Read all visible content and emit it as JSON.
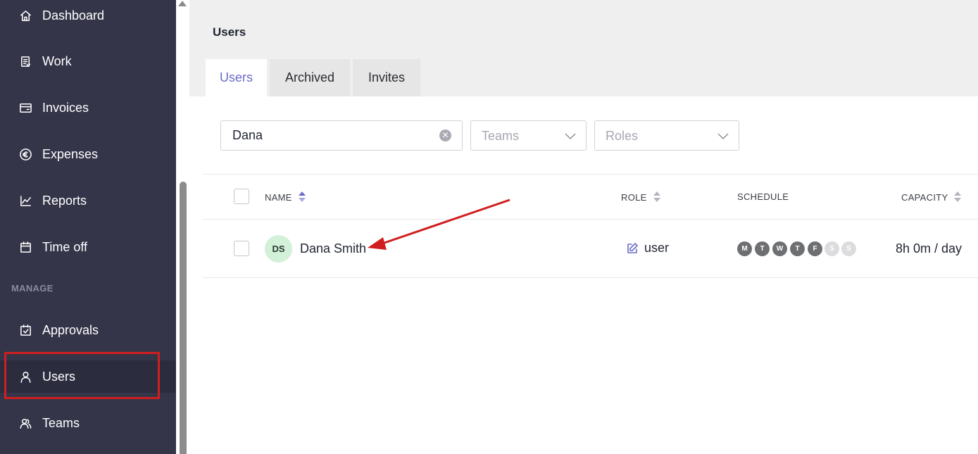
{
  "sidebar": {
    "items": [
      {
        "label": "Dashboard",
        "icon": "home-icon"
      },
      {
        "label": "Work",
        "icon": "clipboard-icon"
      },
      {
        "label": "Invoices",
        "icon": "invoice-icon"
      },
      {
        "label": "Expenses",
        "icon": "euro-icon"
      },
      {
        "label": "Reports",
        "icon": "chart-icon"
      },
      {
        "label": "Time off",
        "icon": "calendar-icon"
      }
    ],
    "section_label": "MANAGE",
    "manage_items": [
      {
        "label": "Approvals",
        "icon": "calendar-check-icon"
      },
      {
        "label": "Users",
        "icon": "user-icon",
        "active": true
      },
      {
        "label": "Teams",
        "icon": "team-icon"
      }
    ]
  },
  "page": {
    "title": "Users",
    "tabs": [
      {
        "label": "Users",
        "active": true
      },
      {
        "label": "Archived"
      },
      {
        "label": "Invites"
      }
    ]
  },
  "filters": {
    "search_value": "Dana",
    "teams_placeholder": "Teams",
    "roles_placeholder": "Roles"
  },
  "table": {
    "columns": {
      "name": "NAME",
      "role": "ROLE",
      "schedule": "SCHEDULE",
      "capacity": "CAPACITY"
    },
    "rows": [
      {
        "initials": "DS",
        "name": "Dana Smith",
        "role": "user",
        "schedule": [
          {
            "day": "M",
            "working": true
          },
          {
            "day": "T",
            "working": true
          },
          {
            "day": "W",
            "working": true
          },
          {
            "day": "T",
            "working": true
          },
          {
            "day": "F",
            "working": true
          },
          {
            "day": "S",
            "working": false
          },
          {
            "day": "S",
            "working": false
          }
        ],
        "capacity": "8h 0m / day"
      }
    ]
  },
  "colors": {
    "sidebar_bg": "#35354a",
    "accent": "#6b6bc9",
    "annotation_red": "#d01e1e",
    "avatar_bg": "#d3f0d9"
  }
}
